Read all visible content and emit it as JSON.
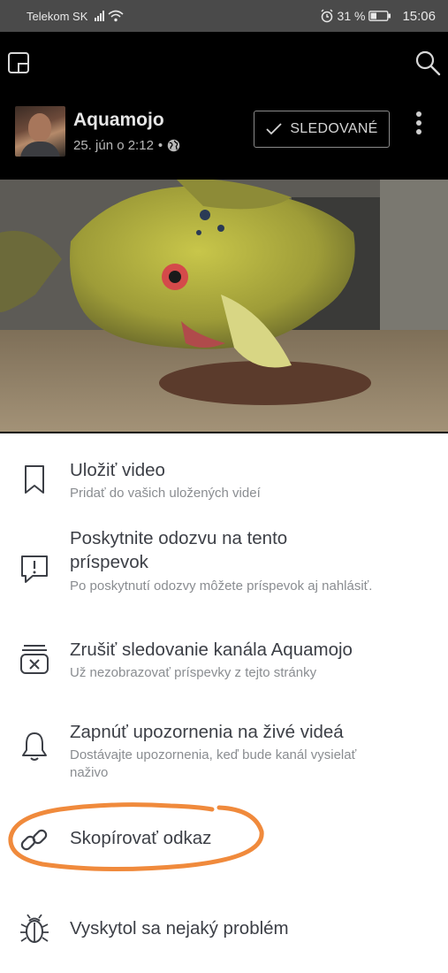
{
  "status_bar": {
    "carrier": "Telekom SK",
    "battery": "31 %",
    "time": "15:06"
  },
  "top_bar": {
    "icons": [
      "picture-in-picture-icon",
      "search-icon"
    ]
  },
  "post": {
    "author": "Aquamojo",
    "date": "25. jún o 2:12",
    "separator": "•",
    "privacy_icon": "globe-icon",
    "follow_label": "SLEDOVANÉ"
  },
  "menu": {
    "items": [
      {
        "icon": "bookmark-icon",
        "title": "Uložiť video",
        "subtitle": "Pridať do vašich uložených videí"
      },
      {
        "icon": "feedback-icon",
        "title": "Poskytnite odozvu na tento príspevok",
        "subtitle": "Po poskytnutí odozvy môžete príspevok aj nahlásiť."
      },
      {
        "icon": "unfollow-icon",
        "title": "Zrušiť sledovanie kanála Aquamojo",
        "subtitle": "Už nezobrazovať príspevky z tejto stránky"
      },
      {
        "icon": "bell-icon",
        "title": "Zapnúť upozornenia na živé videá",
        "subtitle": "Dostávajte upozornenia, keď bude kanál vysielať naživo"
      },
      {
        "icon": "link-icon",
        "title": "Skopírovať odkaz",
        "subtitle": ""
      },
      {
        "icon": "bug-icon",
        "title": "Vyskytol sa nejaký problém",
        "subtitle": ""
      }
    ]
  },
  "annotation": {
    "color": "#f08a3c"
  }
}
